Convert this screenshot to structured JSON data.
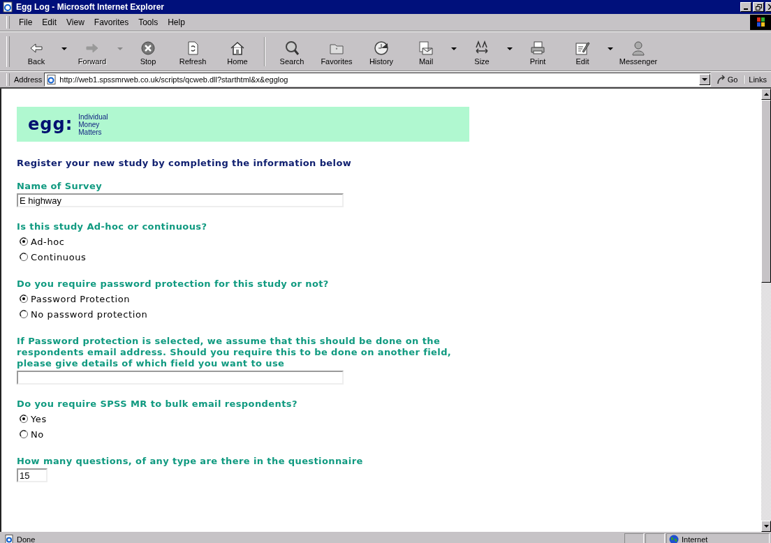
{
  "window": {
    "title": "Egg Log - Microsoft Internet Explorer"
  },
  "menu": [
    {
      "label": "File"
    },
    {
      "label": "Edit"
    },
    {
      "label": "View"
    },
    {
      "label": "Favorites"
    },
    {
      "label": "Tools"
    },
    {
      "label": "Help"
    }
  ],
  "toolbar": [
    [
      {
        "kind": "back",
        "label": "Back",
        "disabled": false,
        "dropdown": true
      },
      {
        "kind": "forward",
        "label": "Forward",
        "disabled": true,
        "dropdown": true
      },
      {
        "kind": "stop",
        "label": "Stop",
        "disabled": false,
        "dropdown": false
      },
      {
        "kind": "refresh",
        "label": "Refresh",
        "disabled": false,
        "dropdown": false
      },
      {
        "kind": "home",
        "label": "Home",
        "disabled": false,
        "dropdown": false
      }
    ],
    [
      {
        "kind": "search",
        "label": "Search",
        "disabled": false,
        "dropdown": false
      },
      {
        "kind": "favorites",
        "label": "Favorites",
        "disabled": false,
        "dropdown": false
      },
      {
        "kind": "history",
        "label": "History",
        "disabled": false,
        "dropdown": false
      },
      {
        "kind": "mail",
        "label": "Mail",
        "disabled": false,
        "dropdown": true
      },
      {
        "kind": "size",
        "label": "Size",
        "disabled": false,
        "dropdown": true
      },
      {
        "kind": "print",
        "label": "Print",
        "disabled": false,
        "dropdown": false
      },
      {
        "kind": "edit",
        "label": "Edit",
        "disabled": false,
        "dropdown": true
      },
      {
        "kind": "messenger",
        "label": "Messenger",
        "disabled": false,
        "dropdown": false
      }
    ]
  ],
  "address": {
    "label": "Address",
    "url": "http://web1.spssmrweb.co.uk/scripts/qcweb.dll?starthtml&x&egglog",
    "go": "Go",
    "links": "Links"
  },
  "page": {
    "banner": {
      "logo": "egg:",
      "tagline": [
        "Individual",
        "Money",
        "Matters"
      ]
    },
    "heading": "Register your new study by completing the information below",
    "questions": [
      {
        "kind": "text",
        "label": "Name of Survey",
        "value": "E highway"
      },
      {
        "kind": "radio",
        "label": "Is this study Ad-hoc or continuous?",
        "options": [
          {
            "label": "Ad-hoc",
            "selected": true
          },
          {
            "label": "Continuous",
            "selected": false
          }
        ]
      },
      {
        "kind": "radio",
        "label": "Do you require password protection for this study or not?",
        "options": [
          {
            "label": "Password Protection",
            "selected": true
          },
          {
            "label": "No password protection",
            "selected": false
          }
        ]
      },
      {
        "kind": "text",
        "label": "If Password protection is selected, we assume that this should be done on the respondents email address. Should you require this to be done on another field, please give details of which field you want to use"
      },
      {
        "kind": "radio",
        "label": "Do you require SPSS MR to bulk email respondents?",
        "options": [
          {
            "label": "Yes",
            "selected": true
          },
          {
            "label": "No",
            "selected": false
          }
        ]
      },
      {
        "kind": "number",
        "label": "How many questions, of any type are there in the questionnaire",
        "value": "15"
      }
    ]
  },
  "status_bar": {
    "text": "Done",
    "zone": "Internet"
  }
}
